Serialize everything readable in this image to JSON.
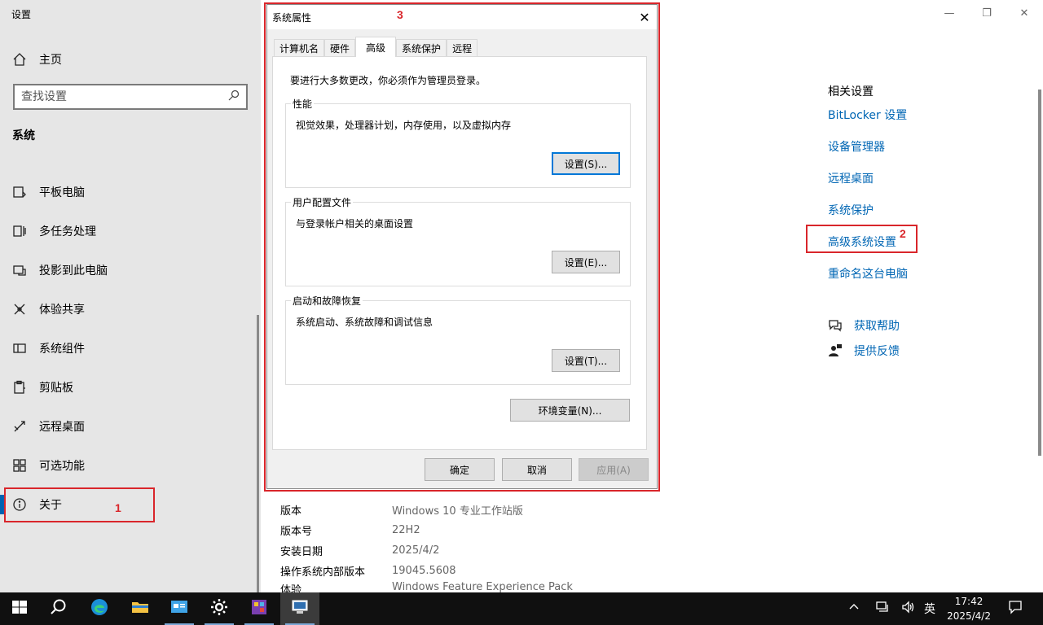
{
  "app": {
    "title": "设置"
  },
  "sidebar": {
    "home_label": "主页",
    "search_placeholder": "查找设置",
    "section_title": "系统",
    "items": [
      {
        "label": "平板电脑",
        "icon": "tablet-icon"
      },
      {
        "label": "多任务处理",
        "icon": "multitask-icon"
      },
      {
        "label": "投影到此电脑",
        "icon": "project-icon"
      },
      {
        "label": "体验共享",
        "icon": "share-icon"
      },
      {
        "label": "系统组件",
        "icon": "components-icon"
      },
      {
        "label": "剪贴板",
        "icon": "clipboard-icon"
      },
      {
        "label": "远程桌面",
        "icon": "remote-desktop-icon"
      },
      {
        "label": "可选功能",
        "icon": "optional-features-icon"
      },
      {
        "label": "关于",
        "icon": "info-icon",
        "selected": true
      }
    ]
  },
  "related": {
    "title": "相关设置",
    "links": [
      "BitLocker 设置",
      "设备管理器",
      "远程桌面",
      "系统保护",
      "高级系统设置",
      "重命名这台电脑"
    ]
  },
  "help": {
    "get_help": "获取帮助",
    "feedback": "提供反馈"
  },
  "specs": [
    {
      "label": "版本",
      "value": "Windows 10 专业工作站版"
    },
    {
      "label": "版本号",
      "value": "22H2"
    },
    {
      "label": "安装日期",
      "value": "2025/4/2"
    },
    {
      "label": "操作系统内部版本",
      "value": "19045.5608"
    },
    {
      "label": "体验",
      "value": "Windows Feature Experience Pack"
    }
  ],
  "dialog": {
    "title": "系统属性",
    "close": "✕",
    "tabs": [
      "计算机名",
      "硬件",
      "高级",
      "系统保护",
      "远程"
    ],
    "active_tab": "高级",
    "admin_note": "要进行大多数更改，你必须作为管理员登录。",
    "performance": {
      "title": "性能",
      "desc": "视觉效果，处理器计划，内存使用，以及虚拟内存",
      "button": "设置(S)..."
    },
    "user_profiles": {
      "title": "用户配置文件",
      "desc": "与登录帐户相关的桌面设置",
      "button": "设置(E)..."
    },
    "startup_recovery": {
      "title": "启动和故障恢复",
      "desc": "系统启动、系统故障和调试信息",
      "button": "设置(T)..."
    },
    "env_button": "环境变量(N)...",
    "ok": "确定",
    "cancel": "取消",
    "apply": "应用(A)"
  },
  "annotations": {
    "one": "1",
    "two": "2",
    "three": "3"
  },
  "tray": {
    "ime": "英",
    "time": "17:42",
    "date": "2025/4/2"
  },
  "colors": {
    "accent": "#0063b1",
    "link": "#0066b4",
    "annotation": "#d9262b",
    "taskbar": "#101010"
  }
}
